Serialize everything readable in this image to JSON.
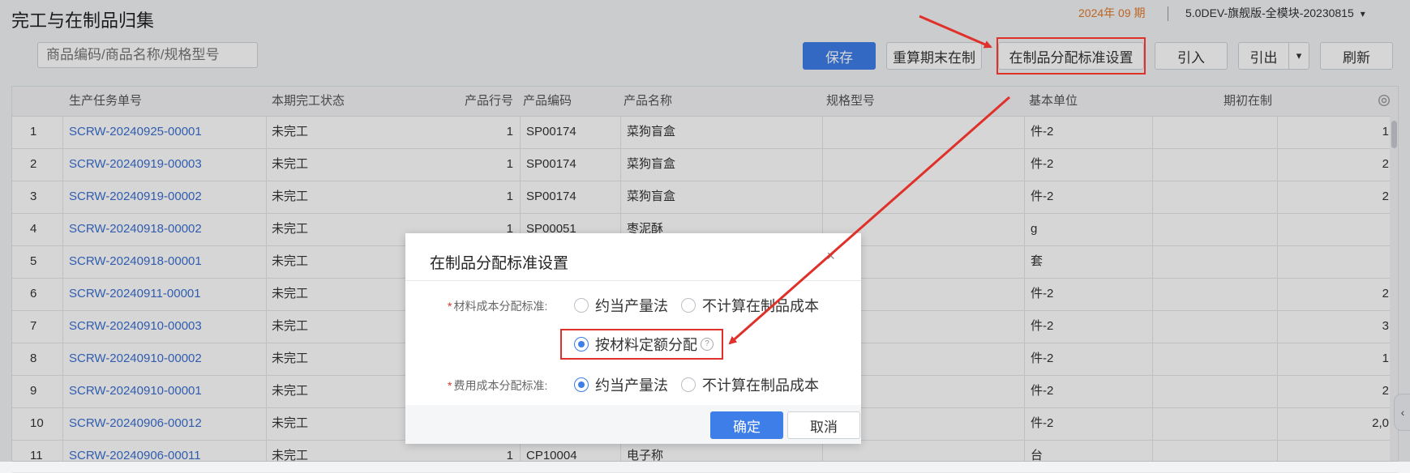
{
  "header": {
    "title": "完工与在制品归集",
    "period": "2024年 09 期",
    "version": "5.0DEV-旗舰版-全模块-20230815"
  },
  "search": {
    "placeholder": "商品编码/商品名称/规格型号"
  },
  "toolbar": {
    "save": "保存",
    "recalc": "重算期末在制",
    "wip_standard": "在制品分配标准设置",
    "import": "引入",
    "export": "引出",
    "refresh": "刷新"
  },
  "table": {
    "columns": {
      "task_no": "生产任务单号",
      "status": "本期完工状态",
      "line_no": "产品行号",
      "code": "产品编码",
      "name": "产品名称",
      "spec": "规格型号",
      "unit": "基本单位",
      "opening": "期初在制"
    },
    "rows": [
      {
        "idx": "1",
        "task": "SCRW-20240925-00001",
        "status": "未完工",
        "line": "1",
        "code": "SP00174",
        "name": "菜狗盲盒",
        "unit": "件-2",
        "opening": "1"
      },
      {
        "idx": "2",
        "task": "SCRW-20240919-00003",
        "status": "未完工",
        "line": "1",
        "code": "SP00174",
        "name": "菜狗盲盒",
        "unit": "件-2",
        "opening": "2"
      },
      {
        "idx": "3",
        "task": "SCRW-20240919-00002",
        "status": "未完工",
        "line": "1",
        "code": "SP00174",
        "name": "菜狗盲盒",
        "unit": "件-2",
        "opening": "2"
      },
      {
        "idx": "4",
        "task": "SCRW-20240918-00002",
        "status": "未完工",
        "line": "1",
        "code": "SP00051",
        "name": "枣泥酥",
        "unit": "g",
        "opening": ""
      },
      {
        "idx": "5",
        "task": "SCRW-20240918-00001",
        "status": "未完工",
        "line": "",
        "code": "",
        "name": "",
        "unit": "套",
        "opening": ""
      },
      {
        "idx": "6",
        "task": "SCRW-20240911-00001",
        "status": "未完工",
        "line": "",
        "code": "",
        "name": "",
        "unit": "件-2",
        "opening": "2"
      },
      {
        "idx": "7",
        "task": "SCRW-20240910-00003",
        "status": "未完工",
        "line": "",
        "code": "",
        "name": "",
        "unit": "件-2",
        "opening": "3"
      },
      {
        "idx": "8",
        "task": "SCRW-20240910-00002",
        "status": "未完工",
        "line": "",
        "code": "",
        "name": "",
        "unit": "件-2",
        "opening": "1"
      },
      {
        "idx": "9",
        "task": "SCRW-20240910-00001",
        "status": "未完工",
        "line": "",
        "code": "",
        "name": "",
        "unit": "件-2",
        "opening": "2"
      },
      {
        "idx": "10",
        "task": "SCRW-20240906-00012",
        "status": "未完工",
        "line": "",
        "code": "",
        "name": "",
        "unit": "件-2",
        "opening": "2,0"
      },
      {
        "idx": "11",
        "task": "SCRW-20240906-00011",
        "status": "未完工",
        "line": "1",
        "code": "CP10004",
        "name": "电子称",
        "unit": "台",
        "opening": ""
      }
    ]
  },
  "dialog": {
    "title": "在制品分配标准设置",
    "close": "×",
    "material_label": "材料成本分配标准:",
    "material_opt1": "约当产量法",
    "material_opt2": "不计算在制品成本",
    "material_opt3": "按材料定额分配",
    "expense_label": "费用成本分配标准:",
    "expense_opt1": "约当产量法",
    "expense_opt2": "不计算在制品成本",
    "ok": "确定",
    "cancel": "取消"
  },
  "colors": {
    "primary": "#3d7ee8",
    "link": "#3b6fd1",
    "annotation": "#e0302a",
    "period": "#e07a2e"
  }
}
